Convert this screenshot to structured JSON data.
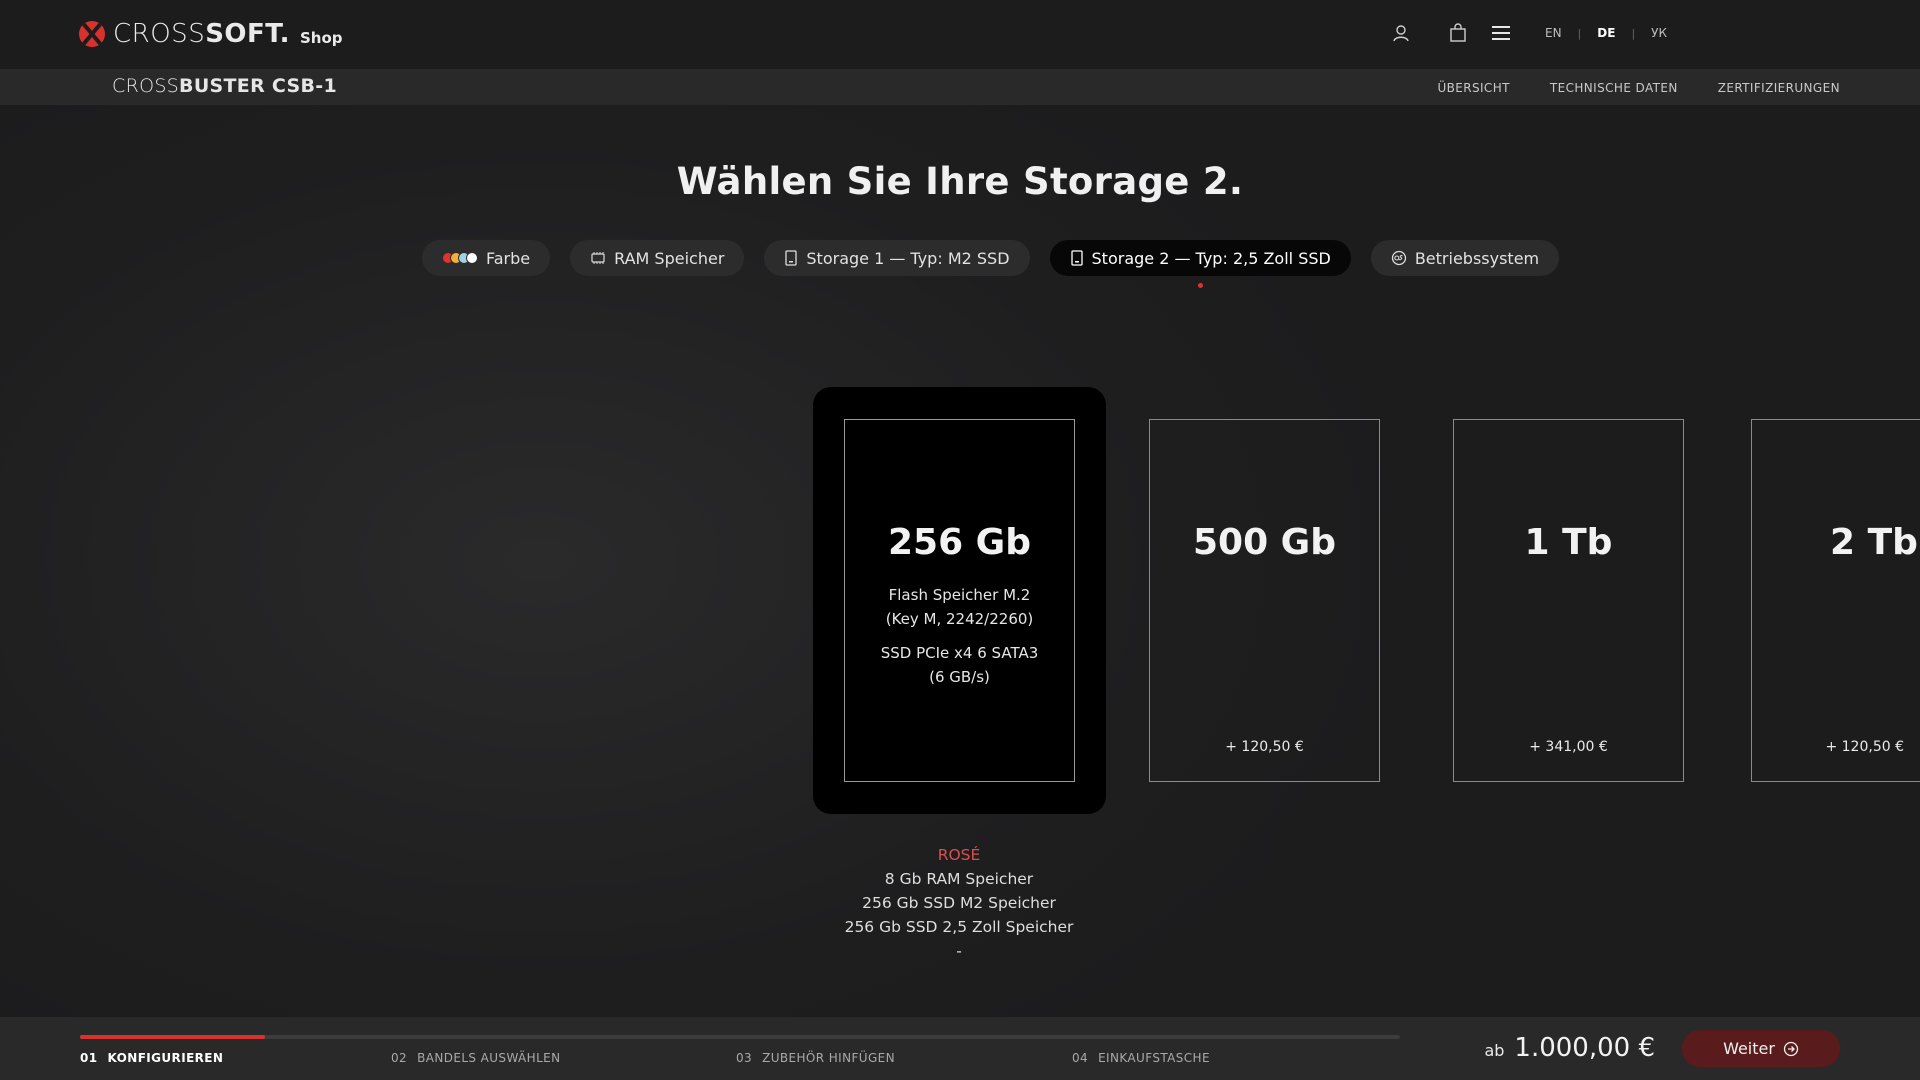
{
  "header": {
    "brand_light": "CROSS",
    "brand_bold": "SOFT.",
    "brand_suffix": "Shop",
    "languages": [
      "EN",
      "DE",
      "УК"
    ],
    "active_language": "DE"
  },
  "subnav": {
    "product_light": "CROSS",
    "product_bold": "BUSTER CSB-1",
    "links": [
      "ÜBERSICHT",
      "TECHNISCHE DATEN",
      "ZERTIFIZIERUNGEN"
    ]
  },
  "title": "Wählen Sie Ihre Storage 2.",
  "tabs": [
    {
      "label": "Farbe",
      "icon": "color-swatch-icon"
    },
    {
      "label": "RAM Speicher",
      "icon": "ram-chip-icon"
    },
    {
      "label": "Storage 1 — Typ: M2 SSD",
      "icon": "storage-icon"
    },
    {
      "label": "Storage 2 — Typ: 2,5 Zoll SSD",
      "icon": "storage-icon",
      "active": true
    },
    {
      "label": "Betriebssystem",
      "icon": "os-icon"
    }
  ],
  "colors": {
    "accent": "#d8322e",
    "swatches": [
      "#e0332f",
      "#f2b134",
      "#9fd1e8",
      "#ffffff"
    ]
  },
  "options": [
    {
      "capacity": "256 Gb",
      "desc1": "Flash Speicher M.2",
      "desc2": "(Key M, 2242/2260)",
      "desc3": "SSD PCIe x4 6 SATA3",
      "desc4": "(6 GB/s)",
      "price": "",
      "selected": true
    },
    {
      "capacity": "500 Gb",
      "price": "+ 120,50 €"
    },
    {
      "capacity": "1 Tb",
      "price": "+ 341,00 €"
    },
    {
      "capacity": "2 Tb",
      "price": "+ 120,50 €"
    }
  ],
  "summary": {
    "color": "ROSÉ",
    "lines": [
      "8 Gb RAM Speicher",
      "256 Gb SSD M2 Speicher",
      "256 Gb SSD 2,5 Zoll Speicher",
      "-"
    ]
  },
  "footer": {
    "progress": 0.14,
    "steps": [
      {
        "num": "01",
        "label": "KONFIGURIEREN",
        "active": true
      },
      {
        "num": "02",
        "label": "BANDELS AUSWÄHLEN"
      },
      {
        "num": "03",
        "label": "ZUBEHÖR HINFÜGEN"
      },
      {
        "num": "04",
        "label": "EINKAUFSTASCHE"
      }
    ],
    "price_prefix": "ab",
    "price": "1.000,00 €",
    "next_label": "Weiter"
  }
}
